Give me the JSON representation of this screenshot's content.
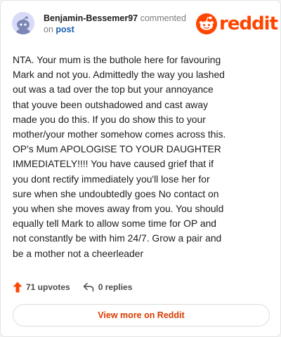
{
  "comment": {
    "username": "Benjamin-Bessemer97",
    "action_text": "commented",
    "on_text": "on",
    "post_link": "post",
    "body": "NTA. Your mum is the buthole here for favouring\nMark and not you. Admittedly the way you lashed\nout was a tad over the top but your annoyance\nthat youve been outshadowed and cast away\nmade you do this. If you do show this to your\nmother/your mother somehow comes across this.\nOP's Mum APOLOGISE TO YOUR DAUGHTER\nIMMEDIATELY!!!! You have caused grief that if\nyou dont rectify immediately you'll lose her for\nsure when she undoubtedly goes No contact on\nyou when she moves away from you. You should\nequally tell Mark to allow some time for OP and\nnot constantly be with him 24/7. Grow a pair and\nbe a mother not a cheerleader"
  },
  "brand": {
    "name": "reddit",
    "color": "#ff4500",
    "icon": "reddit-snoo-icon"
  },
  "actions": {
    "upvotes_label": "71 upvotes",
    "replies_label": "0 replies",
    "upvote_icon": "upvote-arrow-icon",
    "reply_icon": "reply-arrow-icon"
  },
  "footer": {
    "view_more_label": "View more on Reddit"
  },
  "colors": {
    "link_blue": "#1a5fb4",
    "upvote_orange": "#ff4500",
    "button_text": "#d93a00"
  }
}
